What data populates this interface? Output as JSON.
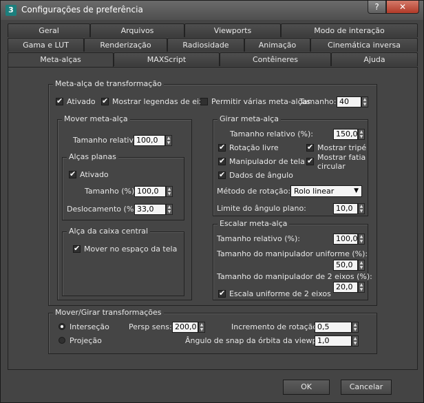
{
  "window": {
    "title": "Configurações de preferência",
    "help": "?",
    "close": "✕"
  },
  "tabs_row1": [
    "Geral",
    "Arquivos",
    "Viewports",
    "Modo de interação"
  ],
  "tabs_row2": [
    "Gama e LUT",
    "Renderização",
    "Radiosidade",
    "Animação",
    "Cinemática inversa"
  ],
  "tabs_row3": [
    "Meta-alças",
    "MAXScript",
    "Contêineres",
    "Ajuda"
  ],
  "transform": {
    "title": "Meta-alça de transformação",
    "enabled": "Ativado",
    "show_axis_labels": "Mostrar legendas de eixo",
    "allow_multiple": "Permitir várias meta-alças",
    "size_label": "Tamanho:",
    "size_value": "40"
  },
  "move": {
    "title": "Mover meta-alça",
    "rel_size_label": "Tamanho relativo",
    "rel_size_value": "100,0",
    "planes": {
      "title": "Alças planas",
      "enabled": "Ativado",
      "size_label": "Tamanho (%):",
      "size_value": "100,0",
      "offset_label": "Deslocamento (%):",
      "offset_value": "33,0"
    },
    "center_box": {
      "title": "Alça da caixa central",
      "move_screen": "Mover no espaço da tela"
    }
  },
  "rotate": {
    "title": "Girar meta-alça",
    "rel_size_label": "Tamanho relativo (%):",
    "rel_size_value": "150,0",
    "free_rotation": "Rotação livre",
    "show_tripod": "Mostrar tripé",
    "screen_manip": "Manipulador de tela",
    "show_pie_a": "Mostrar fatia",
    "show_pie_b": "circular",
    "angle_data": "Dados de ângulo",
    "method_label": "Método de rotação:",
    "method_value": "Rolo linear",
    "plane_limit_label": "Limite do ângulo plano:",
    "plane_limit_value": "10,0"
  },
  "scale": {
    "title": "Escalar meta-alça",
    "rel_size_label": "Tamanho relativo (%):",
    "rel_size_value": "100,0",
    "uniform_label": "Tamanho do manipulador uniforme (%):",
    "uniform_value": "50,0",
    "two_axis_label": "Tamanho do manipulador de 2 eixos (%):",
    "two_axis_value": "20,0",
    "uniform_2axis": "Escala uniforme de 2 eixos"
  },
  "movrot": {
    "title": "Mover/Girar transformações",
    "intersection": "Interseção",
    "projection": "Projeção",
    "persp_label": "Persp sens:",
    "persp_value": "200,0",
    "rot_inc_label": "Incremento de rotação:",
    "rot_inc_value": "0,5",
    "snap_label": "Ângulo de snap da órbita da viewport:",
    "snap_value": "1,0"
  },
  "buttons": {
    "ok": "OK",
    "cancel": "Cancelar"
  }
}
